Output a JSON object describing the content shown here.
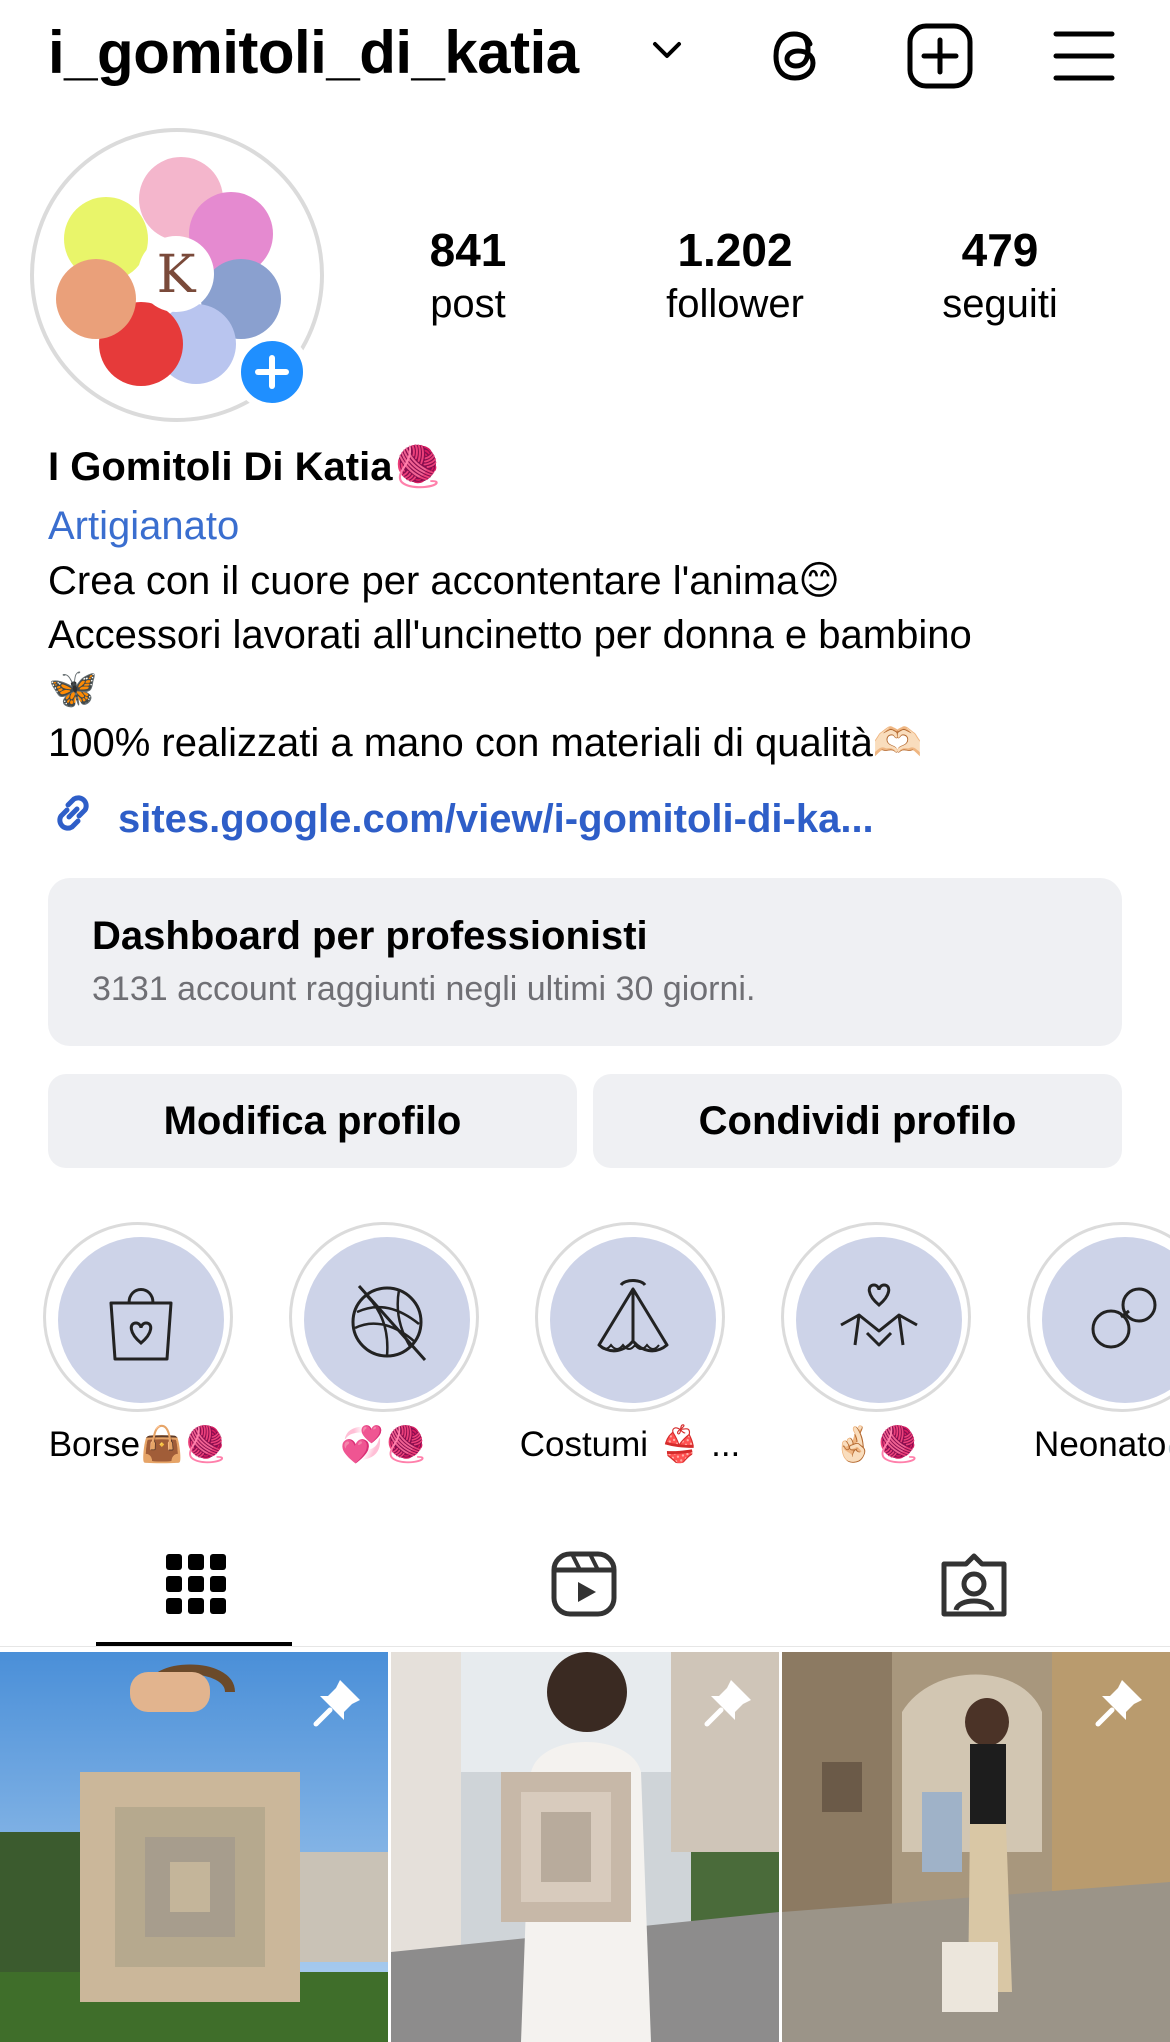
{
  "header": {
    "username": "i_gomitoli_di_katia",
    "icons": [
      "chevron-down-icon",
      "threads-icon",
      "add-post-icon",
      "menu-icon"
    ]
  },
  "profile": {
    "stats": [
      {
        "value": "841",
        "label": "post"
      },
      {
        "value": "1.202",
        "label": "follower"
      },
      {
        "value": "479",
        "label": "seguiti"
      }
    ],
    "name": "I Gomitoli Di Katia🧶",
    "category": "Artigianato",
    "bio_lines": [
      "Crea con il cuore per accontentare l'anima😊",
      "Accessori lavorati all'uncinetto per donna e bambino",
      "🦋",
      "100% realizzati a mano con materiali di qualità🫶🏻"
    ],
    "link": "sites.google.com/view/i-gomitoli-di-ka...",
    "avatar_monogram": "K"
  },
  "dashboard": {
    "title": "Dashboard per professionisti",
    "subtitle": "3131 account raggiunti negli ultimi 30 giorni."
  },
  "buttons": {
    "edit": "Modifica profilo",
    "share": "Condividi profilo"
  },
  "highlights": [
    {
      "label": "Borse👜🧶",
      "icon": "shopping-bag-heart-icon"
    },
    {
      "label": "💞🧶",
      "icon": "yarn-ball-icon"
    },
    {
      "label": "Costumi 👙 ...",
      "icon": "bikini-icon"
    },
    {
      "label": "🤞🏻🧶",
      "icon": "handshake-heart-icon"
    },
    {
      "label": "Neonato🍼",
      "icon": "pacifier-icon"
    }
  ],
  "tabs": [
    "grid-icon",
    "reels-icon",
    "tagged-icon"
  ],
  "posts": [
    {
      "pinned": true
    },
    {
      "pinned": true
    },
    {
      "pinned": true
    }
  ],
  "colors": {
    "link_blue": "#2e5ec8",
    "category_blue": "#3a6ecf",
    "plus_badge": "#1f8fff",
    "highlight_fill": "#cdd3e8",
    "button_gray": "#eff0f3"
  }
}
